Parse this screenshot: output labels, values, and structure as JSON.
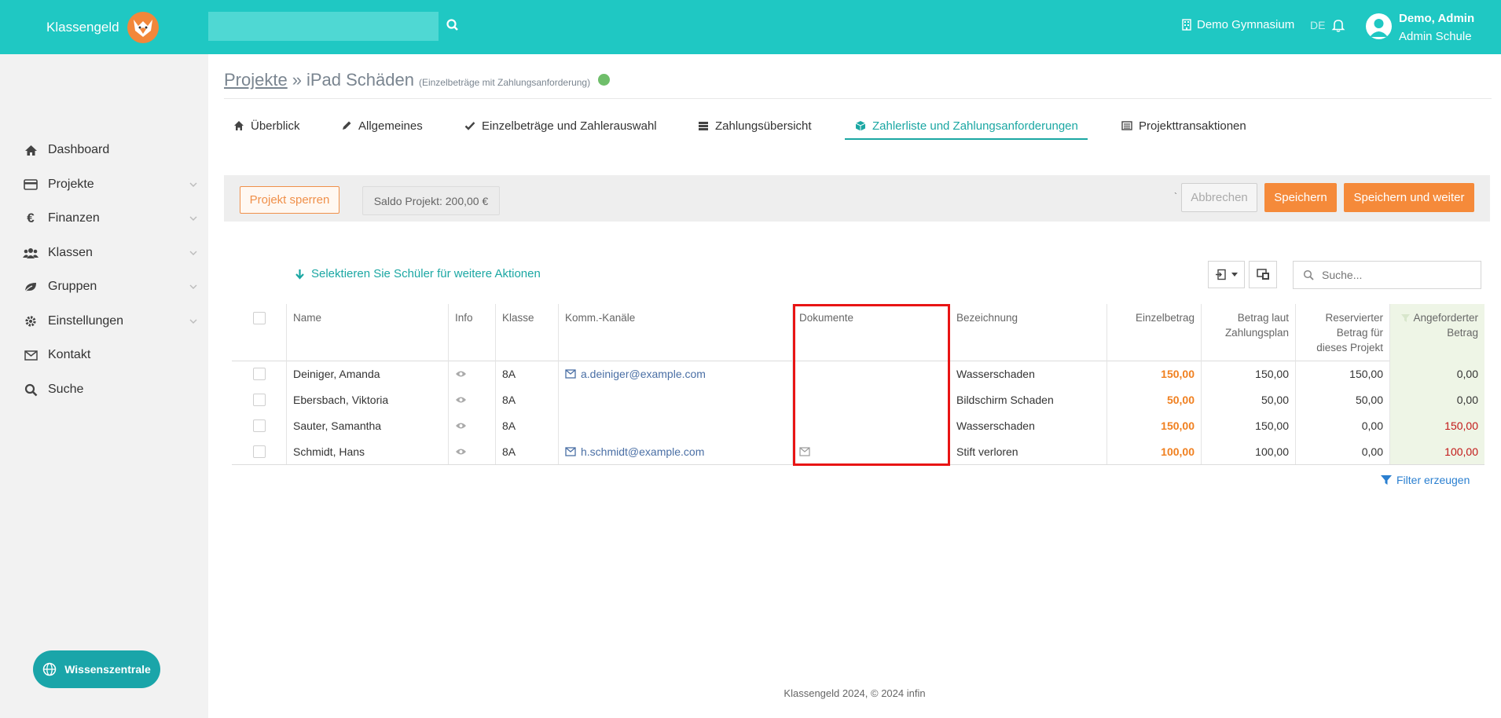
{
  "topbar": {
    "brand": "Klassengeld",
    "search_placeholder": "",
    "school": "Demo Gymnasium",
    "language": "DE",
    "user_name": "Demo, Admin",
    "user_role": "Admin Schule"
  },
  "sidebar": {
    "items": [
      {
        "label": "Dashboard",
        "icon": "home-icon"
      },
      {
        "label": "Projekte",
        "icon": "card-icon"
      },
      {
        "label": "Finanzen",
        "icon": "euro-icon"
      },
      {
        "label": "Klassen",
        "icon": "users-icon"
      },
      {
        "label": "Gruppen",
        "icon": "leaf-icon"
      },
      {
        "label": "Einstellungen",
        "icon": "gear-icon"
      },
      {
        "label": "Kontakt",
        "icon": "envelope-icon"
      },
      {
        "label": "Suche",
        "icon": "search-icon"
      }
    ],
    "wissen": "Wissenszentrale"
  },
  "breadcrumb": {
    "root": "Projekte",
    "separator": "»",
    "current": "iPad Schäden",
    "subtitle": "(Einzelbeträge mit Zahlungsanforderung)"
  },
  "tabs": [
    {
      "label": "Überblick"
    },
    {
      "label": "Allgemeines"
    },
    {
      "label": "Einzelbeträge und Zahlerauswahl"
    },
    {
      "label": "Zahlungsübersicht"
    },
    {
      "label": "Zahlerliste und Zahlungsanforderungen"
    },
    {
      "label": "Projekttransaktionen"
    }
  ],
  "actions": {
    "lock": "Projekt sperren",
    "saldo": "Saldo Projekt: 200,00 €",
    "tick": "`",
    "cancel": "Abbrechen",
    "save": "Speichern",
    "save_continue": "Speichern und weiter"
  },
  "table_tools": {
    "select_hint": "Selektieren Sie Schüler für weitere Aktionen",
    "search_placeholder": "Suche..."
  },
  "table": {
    "headers": {
      "name": "Name",
      "info": "Info",
      "klasse": "Klasse",
      "kanaele": "Komm.-Kanäle",
      "dokumente": "Dokumente",
      "bezeichnung": "Bezeichnung",
      "einzelbetrag": "Einzelbetrag",
      "plan_1": "Betrag laut",
      "plan_2": "Zahlungsplan",
      "reserv_1": "Reservierter",
      "reserv_2": "Betrag für",
      "reserv_3": "dieses Projekt",
      "angef_1": "Angeforderter",
      "angef_2": "Betrag"
    },
    "rows": [
      {
        "name": "Deiniger, Amanda",
        "klasse": "8A",
        "email": "a.deiniger@example.com",
        "doc": false,
        "bezeichnung": "Wasserschaden",
        "einzelbetrag": "150,00",
        "plan": "150,00",
        "reserviert": "150,00",
        "angefordert": "0,00",
        "angef_red": false
      },
      {
        "name": "Ebersbach, Viktoria",
        "klasse": "8A",
        "email": "",
        "doc": false,
        "bezeichnung": "Bildschirm Schaden",
        "einzelbetrag": "50,00",
        "plan": "50,00",
        "reserviert": "50,00",
        "angefordert": "0,00",
        "angef_red": false
      },
      {
        "name": "Sauter, Samantha",
        "klasse": "8A",
        "email": "",
        "doc": false,
        "bezeichnung": "Wasserschaden",
        "einzelbetrag": "150,00",
        "plan": "150,00",
        "reserviert": "0,00",
        "angefordert": "150,00",
        "angef_red": true
      },
      {
        "name": "Schmidt, Hans",
        "klasse": "8A",
        "email": "h.schmidt@example.com",
        "doc": true,
        "bezeichnung": "Stift verloren",
        "einzelbetrag": "100,00",
        "plan": "100,00",
        "reserviert": "0,00",
        "angefordert": "100,00",
        "angef_red": true
      }
    ]
  },
  "filter_link": "Filter erzeugen",
  "footer": "Klassengeld 2024, © 2024 infin",
  "colors": {
    "accent": "#1fc8c3",
    "orange": "#f58a3a",
    "highlight_box": "#e81414"
  }
}
